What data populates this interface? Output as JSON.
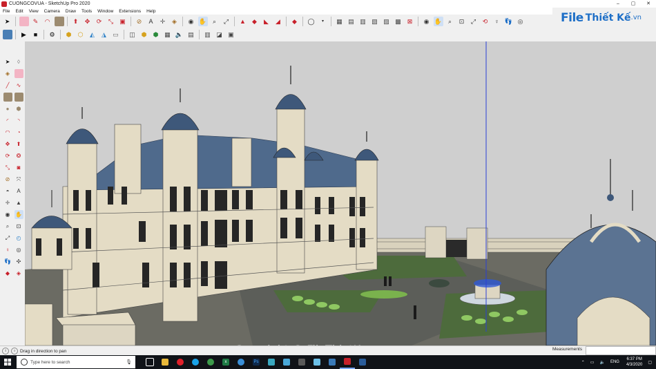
{
  "window": {
    "title": "CUONGCOVUA - SketchUp Pro 2020",
    "controls": [
      "–",
      "▢",
      "✕"
    ]
  },
  "menu": [
    "File",
    "Edit",
    "View",
    "Camera",
    "Draw",
    "Tools",
    "Window",
    "Extensions",
    "Help"
  ],
  "logo": {
    "part1": "File",
    "part2": "Thiết Kế",
    "part3": ".vn"
  },
  "status": {
    "hint": "Drag in direction to pan",
    "measurements_label": "Measurements",
    "measurements_value": ""
  },
  "watermark": "Copyright © FileThietKe.vn",
  "taskbar": {
    "search_placeholder": "Type here to search",
    "tray_lang": "ENG",
    "time": "6:37 PM",
    "date": "4/3/2020"
  },
  "colors": {
    "sky": "#cfcfcf",
    "roof": "#4f6a8c",
    "stone": "#e4dcc5",
    "lawn": "#4d6b3c",
    "axis_blue": "#2a3fd6",
    "accent": "#1e6fc7"
  }
}
